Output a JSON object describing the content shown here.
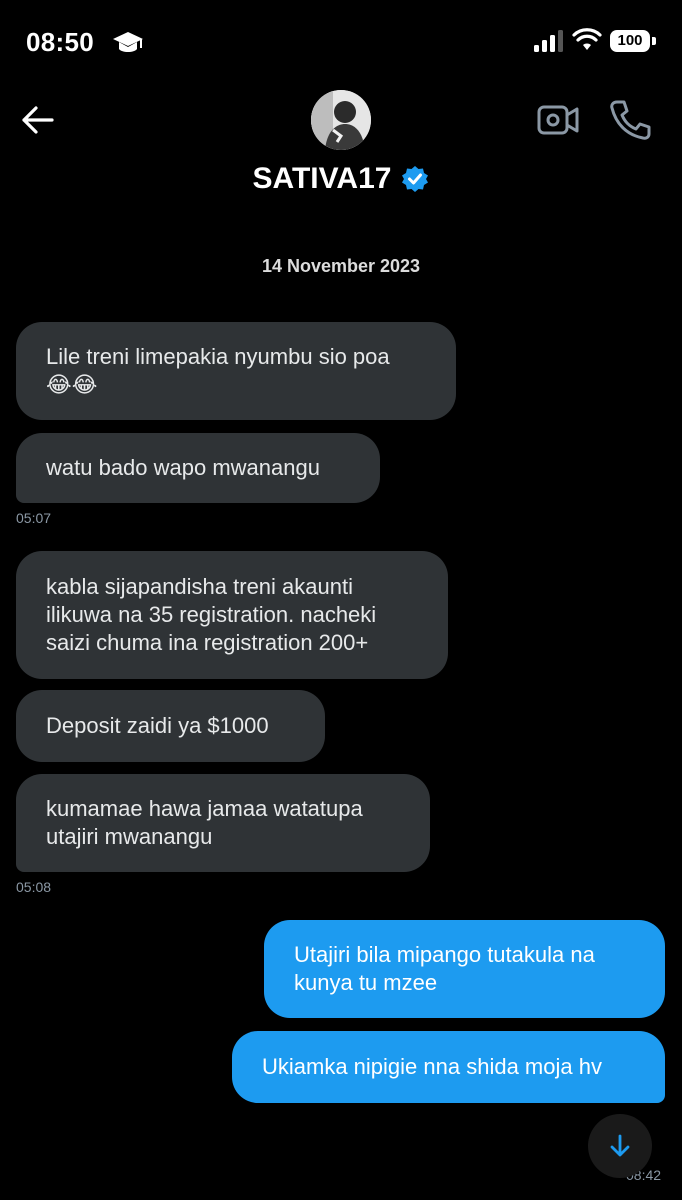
{
  "status_bar": {
    "time": "08:50",
    "battery": "100"
  },
  "header": {
    "contact_name": "SATIVA17"
  },
  "conversation": {
    "date": "14 November 2023",
    "messages": [
      {
        "text": "Lile treni limepakia nyumbu sio poa",
        "emoji": "😂😂",
        "direction": "incoming"
      },
      {
        "text": "watu bado wapo mwanangu",
        "direction": "incoming"
      },
      {
        "text": "kabla sijapandisha treni akaunti ilikuwa na 35 registration. nacheki saizi chuma ina registration 200+",
        "direction": "incoming"
      },
      {
        "text": "Deposit zaidi ya $1000",
        "direction": "incoming"
      },
      {
        "text": "kumamae hawa jamaa watatupa utajiri mwanangu",
        "direction": "incoming"
      },
      {
        "text": "Utajiri bila mipango tutakula na kunya tu mzee",
        "direction": "outgoing"
      },
      {
        "text": "Ukiamka nipigie nna shida moja hv",
        "direction": "outgoing"
      }
    ],
    "timestamps": [
      "05:07",
      "05:08",
      "08:42"
    ]
  },
  "colors": {
    "incoming_bubble": "#2f3336",
    "outgoing_bubble": "#1d9bf0",
    "background": "#000000",
    "verified": "#1d9bf0"
  }
}
